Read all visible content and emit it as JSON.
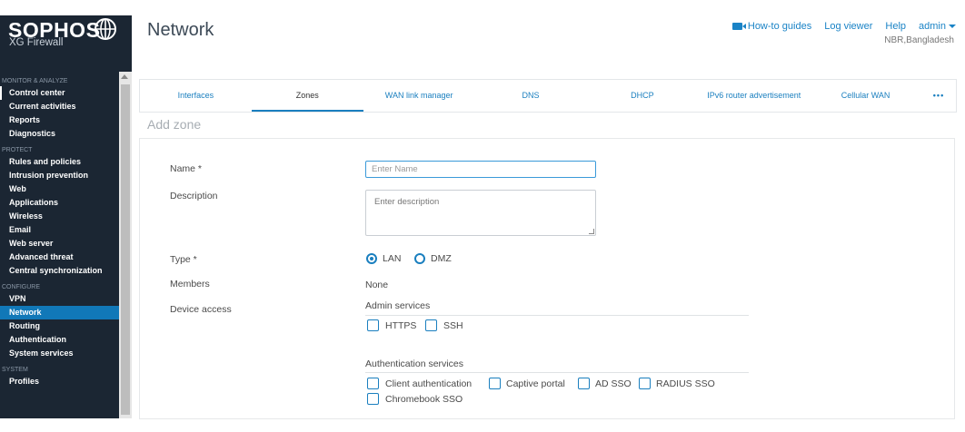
{
  "brand": {
    "name": "SOPHOS",
    "product": "XG Firewall"
  },
  "sidebar": {
    "sections": [
      {
        "title": "MONITOR & ANALYZE",
        "items": [
          "Control center",
          "Current activities",
          "Reports",
          "Diagnostics"
        ]
      },
      {
        "title": "PROTECT",
        "items": [
          "Rules and policies",
          "Intrusion prevention",
          "Web",
          "Applications",
          "Wireless",
          "Email",
          "Web server",
          "Advanced threat",
          "Central synchronization"
        ]
      },
      {
        "title": "CONFIGURE",
        "items": [
          "VPN",
          "Network",
          "Routing",
          "Authentication",
          "System services"
        ]
      },
      {
        "title": "SYSTEM",
        "items": [
          "Profiles"
        ]
      }
    ],
    "active_item": "Control center",
    "selected_item": "Network"
  },
  "header": {
    "title": "Network",
    "links": {
      "howto": "How-to guides",
      "log": "Log viewer",
      "help": "Help",
      "user": "admin"
    },
    "location": "NBR,Bangladesh"
  },
  "tabs": [
    {
      "label": "Interfaces",
      "active": false
    },
    {
      "label": "Zones",
      "active": true
    },
    {
      "label": "WAN link manager",
      "active": false
    },
    {
      "label": "DNS",
      "active": false
    },
    {
      "label": "DHCP",
      "active": false
    },
    {
      "label": "IPv6 router advertisement",
      "active": false
    },
    {
      "label": "Cellular WAN",
      "active": false
    },
    {
      "label": "•••",
      "active": false
    }
  ],
  "section_title": "Add zone",
  "form": {
    "name_label": "Name *",
    "name_placeholder": "Enter Name",
    "name_value": "",
    "description_label": "Description",
    "description_placeholder": "Enter description",
    "type_label": "Type *",
    "type_options": [
      "LAN",
      "DMZ"
    ],
    "type_selected": "LAN",
    "members_label": "Members",
    "members_value": "None",
    "device_access_label": "Device access",
    "admin_services_title": "Admin services",
    "admin_services": [
      "HTTPS",
      "SSH"
    ],
    "auth_services_title": "Authentication services",
    "auth_services": [
      "Client authentication",
      "Captive portal",
      "AD SSO",
      "RADIUS SSO",
      "Chromebook SSO"
    ]
  },
  "colors": {
    "accent": "#1a7fbf",
    "sidebar_bg": "#1b2633",
    "selected_bg": "#1178b8"
  }
}
